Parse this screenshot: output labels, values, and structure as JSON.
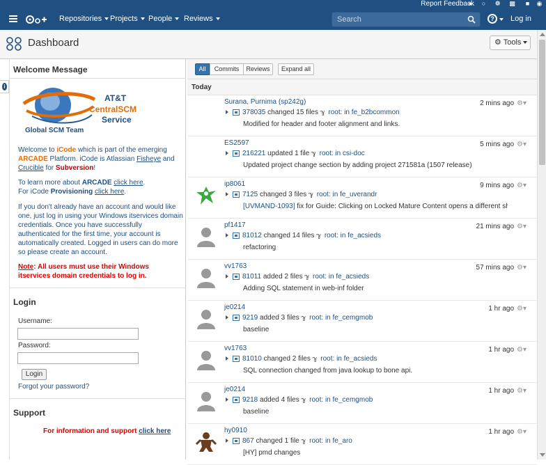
{
  "utilbar": {
    "report_feedback": "Report Feedback"
  },
  "nav": {
    "items": [
      "Repositories",
      "Projects",
      "People",
      "Reviews"
    ],
    "search_placeholder": "Search",
    "login": "Log in"
  },
  "header": {
    "title": "Dashboard",
    "tools": "Tools"
  },
  "left": {
    "welcome_title": "Welcome Message",
    "logo_lines": [
      "AT&T",
      "CentralSCM",
      "Service",
      "Global SCM Team"
    ],
    "p1": {
      "a": "Welcome to ",
      "icode": "iCode",
      "b": " which is part of the emerging ",
      "arcade": "ARCADE",
      "c": " Platform. iCode is Atlassian ",
      "fisheye": "Fisheye",
      "d": " and ",
      "crucible": "Crucible",
      "e": " for ",
      "subversion": "Subversion",
      "f": "!"
    },
    "p2": {
      "a": "To learn more about ",
      "arcade": "ARCADE",
      "link1": "click here",
      "b": ".",
      "c": "For iCode ",
      "prov": "Provisioning",
      "link2": "click here",
      "d": "."
    },
    "p3": "If you don't already have an account and would like one, just log in using your Windows itservices domain credentials. Once you have successfully authenticated for the first time, your account is automatically created. Logged in users can do more so please create an account.",
    "note_label": "Note",
    "note_text": ": All users must use their Windows itservices domain credentials to log in",
    "note_end": ".",
    "login_title": "Login",
    "username_label": "Username:",
    "password_label": "Password:",
    "login_button": "Login",
    "forgot": "Forgot your password?",
    "support_title": "Support",
    "support_text": "For information and support ",
    "support_link": "click here"
  },
  "stream": {
    "filters": [
      "All",
      "Commits",
      "Reviews"
    ],
    "expand": "Expand all",
    "today": "Today",
    "items": [
      {
        "author": "Surana, Purnima (sp242g)",
        "cs": "378035",
        "action": " changed 15 files ",
        "branch": "root: in fe_b2bcommon",
        "msg": "Modified for header and footer alignment and links.",
        "time": "2 mins ago",
        "avatar": "blank"
      },
      {
        "author": "ES2597",
        "cs": "216221",
        "action": " updated 1 file ",
        "branch": "root: in csi-doc",
        "msg": "Updated project change section by adding project 271581a (1507 release)",
        "time": "5 mins ago",
        "avatar": "blank"
      },
      {
        "author": "ip8061",
        "cs": "7125",
        "action": " changed 3 files ",
        "branch": "root: in fe_uverandr",
        "msg_link": "[UVMAND-1093]",
        "msg": " fix for Guide: Clicking on Locked Mature Content opens a different sho...",
        "time": "9 mins ago",
        "avatar": "green"
      },
      {
        "author": "pf1417",
        "cs": "81012",
        "action": " changed 14 files ",
        "branch": "root: in fe_acsieds",
        "msg": "refactoring",
        "time": "21 mins ago",
        "avatar": "person"
      },
      {
        "author": "vv1763",
        "cs": "81011",
        "action": " added 2 files ",
        "branch": "root: in fe_acsieds",
        "msg": "Adding SQL statement in web-inf folder",
        "time": "57 mins ago",
        "avatar": "person"
      },
      {
        "author": "je0214",
        "cs": "9219",
        "action": " added 3 files ",
        "branch": "root: in fe_cemgmob",
        "msg": "baseline",
        "time": "1 hr ago",
        "avatar": "person"
      },
      {
        "author": "vv1763",
        "cs": "81010",
        "action": " changed 2 files ",
        "branch": "root: in fe_acsieds",
        "msg": "SQL connection changed from java lookup to bone api.",
        "time": "1 hr ago",
        "avatar": "person"
      },
      {
        "author": "je0214",
        "cs": "9218",
        "action": " added 4 files ",
        "branch": "root: in fe_cemgmob",
        "msg": "baseline",
        "time": "1 hr ago",
        "avatar": "person"
      },
      {
        "author": "hy0910",
        "cs": "867",
        "action": " changed 1 file ",
        "branch": "root: in fe_aro",
        "msg": "[HY] pmd changes",
        "time": "1 hr ago",
        "avatar": "brown"
      }
    ]
  },
  "colors": {
    "nav": "#205081",
    "link": "#205081",
    "orange": "#e36c09",
    "red": "#e00000"
  }
}
